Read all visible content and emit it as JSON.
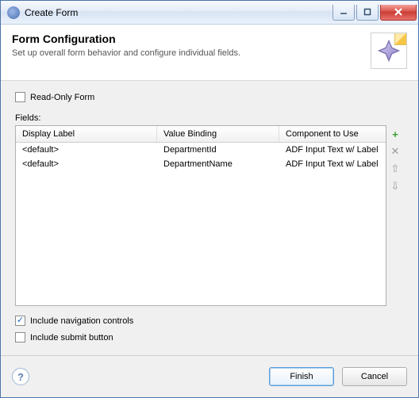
{
  "window": {
    "title": "Create Form"
  },
  "header": {
    "title": "Form Configuration",
    "subtitle": "Set up overall form behavior and configure individual fields."
  },
  "options": {
    "readonly_label": "Read-Only Form",
    "readonly_checked": false,
    "fields_label": "Fields:",
    "nav_label": "Include navigation controls",
    "nav_checked": true,
    "submit_label": "Include submit button",
    "submit_checked": false
  },
  "table": {
    "columns": [
      "Display Label",
      "Value Binding",
      "Component to Use"
    ],
    "rows": [
      {
        "label": "<default>",
        "binding": "DepartmentId",
        "component": "ADF Input Text w/ Label"
      },
      {
        "label": "<default>",
        "binding": "DepartmentName",
        "component": "ADF Input Text w/ Label"
      }
    ]
  },
  "sidebtns": {
    "add": "+",
    "remove": "✕",
    "up": "⇧",
    "down": "⇩"
  },
  "footer": {
    "help": "?",
    "finish": "Finish",
    "cancel": "Cancel"
  }
}
